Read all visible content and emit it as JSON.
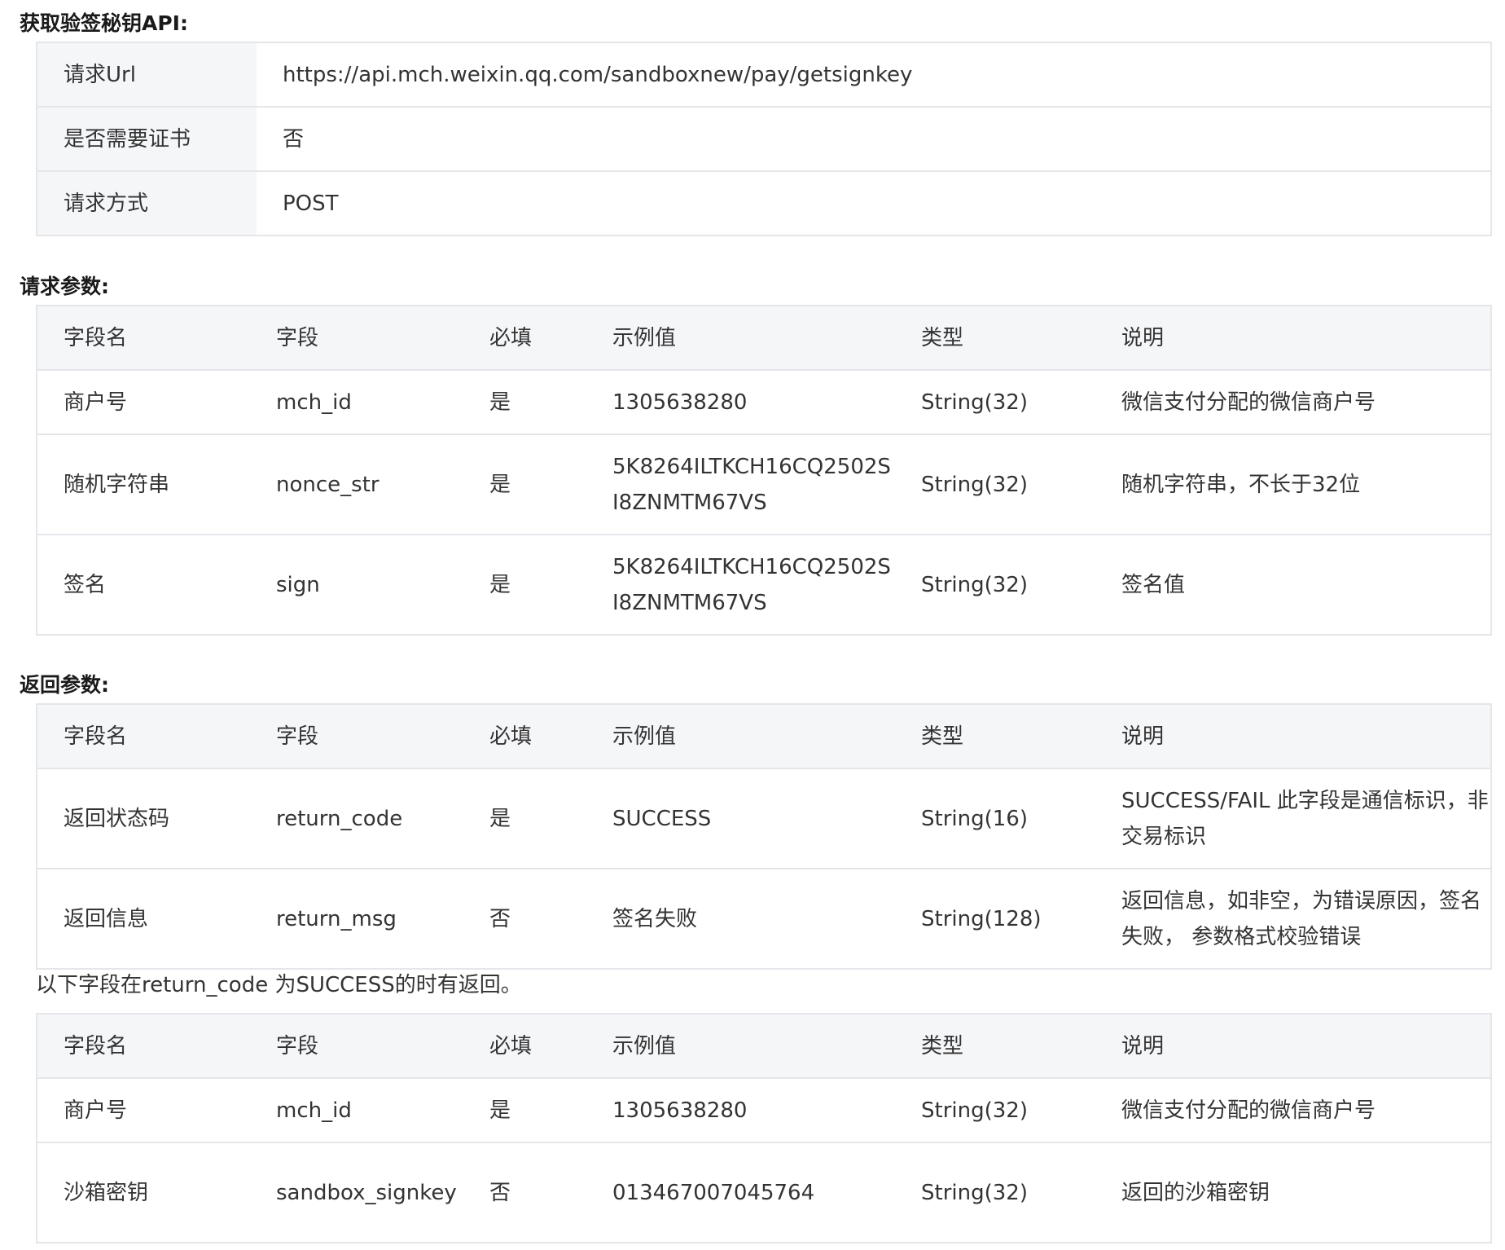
{
  "sections": {
    "api_title": "获取验签秘钥API:",
    "request_title": "请求参数:",
    "response_title": "返回参数:"
  },
  "api_info": [
    {
      "key": "请求Url",
      "value": "https://api.mch.weixin.qq.com/sandboxnew/pay/getsignkey"
    },
    {
      "key": "是否需要证书",
      "value": "否"
    },
    {
      "key": "请求方式",
      "value": "POST"
    }
  ],
  "headers": [
    "字段名",
    "字段",
    "必填",
    "示例值",
    "类型",
    "说明"
  ],
  "request_params": [
    [
      "商户号",
      "mch_id",
      "是",
      "1305638280",
      "String(32)",
      "微信支付分配的微信商户号"
    ],
    [
      "随机字符串",
      "nonce_str",
      "是",
      "5K8264ILTKCH16CQ2502SI8ZNMTM67VS",
      "String(32)",
      "随机字符串，不长于32位"
    ],
    [
      "签名",
      "sign",
      "是",
      "5K8264ILTKCH16CQ2502SI8ZNMTM67VS",
      "String(32)",
      "签名值"
    ]
  ],
  "response_params": [
    [
      "返回状态码",
      "return_code",
      "是",
      "SUCCESS",
      "String(16)",
      "SUCCESS/FAIL 此字段是通信标识，非交易标识"
    ],
    [
      "返回信息",
      "return_msg",
      "否",
      "签名失败",
      "String(128)",
      "返回信息，如非空，为错误原因，签名失败， 参数格式校验错误"
    ]
  ],
  "success_note": "以下字段在return_code 为SUCCESS的时有返回。",
  "success_params": [
    [
      "商户号",
      "mch_id",
      "是",
      "1305638280",
      "String(32)",
      "微信支付分配的微信商户号"
    ],
    [
      "沙箱密钥",
      "sandbox_signkey",
      "否",
      "013467007045764",
      "String(32)",
      "返回的沙箱密钥"
    ]
  ]
}
